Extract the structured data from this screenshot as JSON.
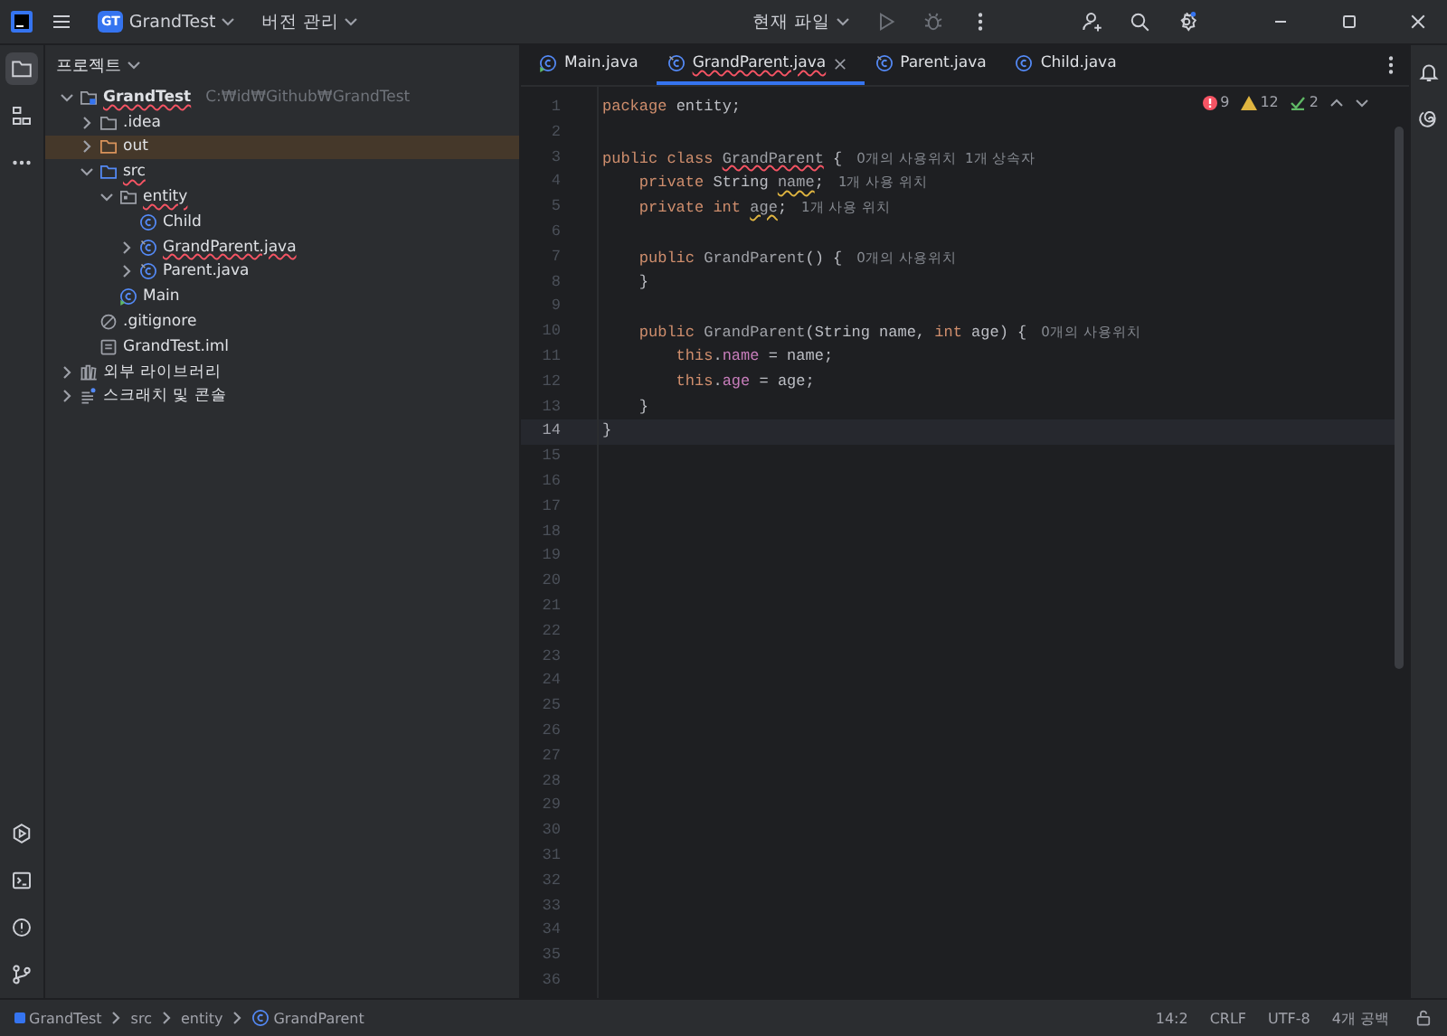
{
  "titlebar": {
    "project_badge": "GT",
    "project": "GrandTest",
    "vcs": "버전 관리",
    "run_config": "현재 파일"
  },
  "project_panel": {
    "title": "프로젝트",
    "tree": [
      {
        "label": "GrandTest",
        "path": "C:₩id₩Github₩GrandTest",
        "kind": "module",
        "expanded": true,
        "selected": false,
        "has_error": true,
        "children": [
          {
            "label": ".idea",
            "kind": "folder",
            "expanded": false,
            "selected": false,
            "has_error": false
          },
          {
            "label": "out",
            "kind": "excluded",
            "expanded": false,
            "selected": true,
            "has_error": false
          },
          {
            "label": "src",
            "kind": "source",
            "expanded": true,
            "selected": false,
            "has_error": true,
            "children": [
              {
                "label": "entity",
                "kind": "package",
                "expanded": true,
                "selected": false,
                "has_error": true,
                "children": [
                  {
                    "label": "Child",
                    "kind": "class",
                    "selected": false,
                    "has_error": false
                  },
                  {
                    "label": "GrandParent.java",
                    "kind": "file",
                    "expanded": false,
                    "selected": false,
                    "has_error": true
                  },
                  {
                    "label": "Parent.java",
                    "kind": "file",
                    "expanded": false,
                    "selected": false,
                    "has_error": false
                  }
                ]
              },
              {
                "label": "Main",
                "kind": "main",
                "selected": false,
                "has_error": false
              }
            ]
          },
          {
            "label": ".gitignore",
            "kind": "ignore",
            "selected": false,
            "has_error": false
          },
          {
            "label": "GrandTest.iml",
            "kind": "iml",
            "selected": false,
            "has_error": false
          }
        ]
      },
      {
        "label": "외부 라이브러리",
        "kind": "libraries",
        "expanded": false,
        "selected": false,
        "has_error": false
      },
      {
        "label": "스크래치 및 콘솔",
        "kind": "scratches",
        "expanded": false,
        "selected": false,
        "has_error": false
      }
    ]
  },
  "tabs": [
    {
      "label": "Main.java",
      "kind": "main",
      "selected": false,
      "has_error": false
    },
    {
      "label": "GrandParent.java",
      "kind": "file",
      "selected": true,
      "has_error": true
    },
    {
      "label": "Parent.java",
      "kind": "file",
      "selected": false,
      "has_error": false
    },
    {
      "label": "Child.java",
      "kind": "class",
      "selected": false,
      "has_error": false
    }
  ],
  "inspections": {
    "errors": "9",
    "warnings": "12",
    "ok": "2"
  },
  "editor": {
    "lines": [
      {
        "number": "1",
        "current": false,
        "tokens": [
          {
            "text": "package ",
            "kind": "keyword"
          },
          {
            "text": "entity;",
            "kind": "plain"
          }
        ]
      },
      {
        "number": "2",
        "current": false
      },
      {
        "number": "3",
        "current": false,
        "tokens": [
          {
            "text": "public class ",
            "kind": "keyword"
          },
          {
            "text": "GrandParent",
            "kind": "error-ident"
          },
          {
            "text": " {",
            "kind": "plain"
          },
          {
            "text": "0개의 사용위치  1개 상속자",
            "kind": "hint"
          }
        ]
      },
      {
        "number": "4",
        "current": false,
        "tokens": [
          {
            "text": "    private ",
            "kind": "keyword"
          },
          {
            "text": "String ",
            "kind": "plain"
          },
          {
            "text": "name",
            "kind": "warn-ident"
          },
          {
            "text": ";",
            "kind": "plain"
          },
          {
            "text": "1개 사용 위치",
            "kind": "hint"
          }
        ]
      },
      {
        "number": "5",
        "current": false,
        "tokens": [
          {
            "text": "    private int ",
            "kind": "keyword"
          },
          {
            "text": "age",
            "kind": "warn-ident"
          },
          {
            "text": ";",
            "kind": "plain"
          },
          {
            "text": "1개 사용 위치",
            "kind": "hint"
          }
        ]
      },
      {
        "number": "6",
        "current": false
      },
      {
        "number": "7",
        "current": false,
        "tokens": [
          {
            "text": "    public ",
            "kind": "keyword"
          },
          {
            "text": "GrandParent",
            "kind": "unused"
          },
          {
            "text": "() {",
            "kind": "plain"
          },
          {
            "text": "0개의 사용위치",
            "kind": "hint"
          }
        ]
      },
      {
        "number": "8",
        "current": false,
        "tokens": [
          {
            "text": "    }",
            "kind": "plain"
          }
        ]
      },
      {
        "number": "9",
        "current": false
      },
      {
        "number": "10",
        "current": false,
        "tokens": [
          {
            "text": "    public ",
            "kind": "keyword"
          },
          {
            "text": "GrandParent",
            "kind": "unused"
          },
          {
            "text": "(String name, ",
            "kind": "plain"
          },
          {
            "text": "int ",
            "kind": "keyword"
          },
          {
            "text": "age) {",
            "kind": "plain"
          },
          {
            "text": "0개의 사용위치",
            "kind": "hint"
          }
        ]
      },
      {
        "number": "11",
        "current": false,
        "tokens": [
          {
            "text": "        this",
            "kind": "keyword"
          },
          {
            "text": ".",
            "kind": "plain"
          },
          {
            "text": "name",
            "kind": "field"
          },
          {
            "text": " = name;",
            "kind": "plain"
          }
        ]
      },
      {
        "number": "12",
        "current": false,
        "tokens": [
          {
            "text": "        this",
            "kind": "keyword"
          },
          {
            "text": ".",
            "kind": "plain"
          },
          {
            "text": "age",
            "kind": "field"
          },
          {
            "text": " = age;",
            "kind": "plain"
          }
        ]
      },
      {
        "number": "13",
        "current": false,
        "tokens": [
          {
            "text": "    }",
            "kind": "plain"
          }
        ]
      },
      {
        "number": "14",
        "current": true,
        "tokens": [
          {
            "text": "}",
            "kind": "plain"
          }
        ]
      },
      {
        "number": "15",
        "current": false
      },
      {
        "number": "16",
        "current": false
      },
      {
        "number": "17",
        "current": false
      },
      {
        "number": "18",
        "current": false
      },
      {
        "number": "19",
        "current": false
      },
      {
        "number": "20",
        "current": false
      },
      {
        "number": "21",
        "current": false
      },
      {
        "number": "22",
        "current": false
      },
      {
        "number": "23",
        "current": false
      },
      {
        "number": "24",
        "current": false
      },
      {
        "number": "25",
        "current": false
      },
      {
        "number": "26",
        "current": false
      },
      {
        "number": "27",
        "current": false
      },
      {
        "number": "28",
        "current": false
      },
      {
        "number": "29",
        "current": false
      },
      {
        "number": "30",
        "current": false
      },
      {
        "number": "31",
        "current": false
      },
      {
        "number": "32",
        "current": false
      },
      {
        "number": "33",
        "current": false
      },
      {
        "number": "34",
        "current": false
      },
      {
        "number": "35",
        "current": false
      },
      {
        "number": "36",
        "current": false
      }
    ]
  },
  "status_bar": {
    "breadcrumbs": [
      {
        "label": "GrandTest",
        "kind": "module"
      },
      {
        "label": "src",
        "kind": "plain"
      },
      {
        "label": "entity",
        "kind": "plain"
      },
      {
        "label": "GrandParent",
        "kind": "class"
      }
    ],
    "items": [
      "14:2",
      "CRLF",
      "UTF-8",
      "4개 공백"
    ]
  }
}
